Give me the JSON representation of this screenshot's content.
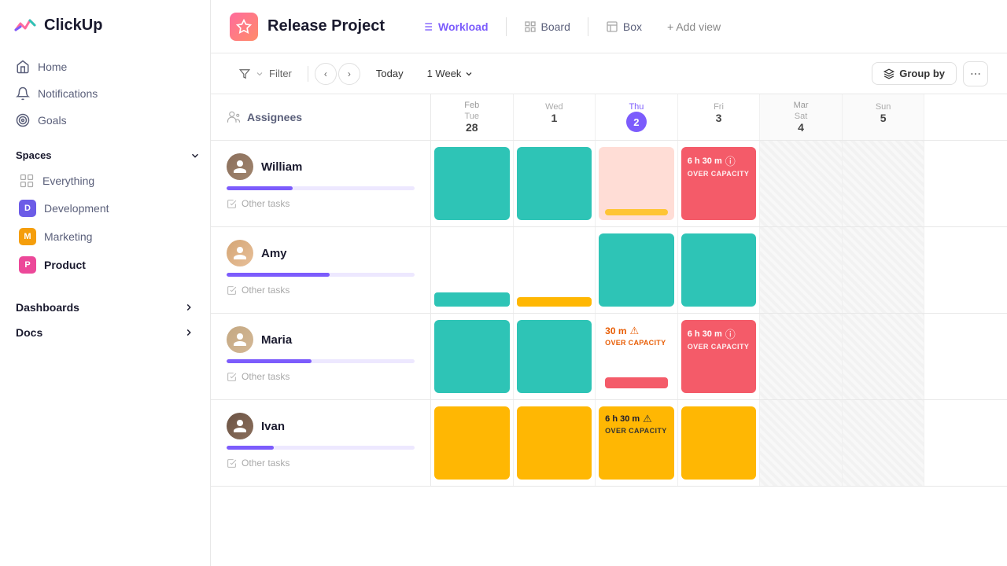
{
  "app": {
    "name": "ClickUp"
  },
  "sidebar": {
    "logo_text": "ClickUp",
    "nav_items": [
      {
        "id": "home",
        "label": "Home",
        "icon": "🏠"
      },
      {
        "id": "notifications",
        "label": "Notifications",
        "icon": "🔔"
      },
      {
        "id": "goals",
        "label": "Goals",
        "icon": "🎯"
      }
    ],
    "spaces_label": "Spaces",
    "space_items": [
      {
        "id": "everything",
        "label": "Everything",
        "icon": "grid",
        "color": null
      },
      {
        "id": "development",
        "label": "Development",
        "badge": "D",
        "color": "#6c5ce7"
      },
      {
        "id": "marketing",
        "label": "Marketing",
        "badge": "M",
        "color": "#f59e0b"
      },
      {
        "id": "product",
        "label": "Product",
        "badge": "P",
        "color": "#ec4899",
        "active": true
      }
    ],
    "dashboards_label": "Dashboards",
    "docs_label": "Docs"
  },
  "header": {
    "project_name": "Release Project",
    "tabs": [
      {
        "id": "workload",
        "label": "Workload",
        "active": true
      },
      {
        "id": "board",
        "label": "Board"
      },
      {
        "id": "box",
        "label": "Box"
      },
      {
        "id": "add",
        "label": "+ Add view"
      }
    ]
  },
  "toolbar": {
    "filter_label": "Filter",
    "today_label": "Today",
    "week_label": "1 Week",
    "group_by_label": "Group by"
  },
  "grid": {
    "assignees_label": "Assignees",
    "dates": [
      {
        "month": "Feb",
        "day_name": "Tue",
        "day_num": "28",
        "today": false,
        "weekend": false
      },
      {
        "month": "",
        "day_name": "Wed",
        "day_num": "1",
        "today": false,
        "weekend": false
      },
      {
        "month": "",
        "day_name": "Thu",
        "day_num": "2",
        "today": true,
        "weekend": false
      },
      {
        "month": "",
        "day_name": "Fri",
        "day_num": "3",
        "today": false,
        "weekend": false
      },
      {
        "month": "Mar",
        "day_name": "Sat",
        "day_num": "4",
        "today": false,
        "weekend": true
      },
      {
        "month": "",
        "day_name": "Sun",
        "day_num": "5",
        "today": false,
        "weekend": true
      }
    ],
    "assignees": [
      {
        "name": "William",
        "avatar_color": "#8b6f5c",
        "progress": 35,
        "other_tasks": "Other tasks",
        "cells": [
          {
            "type": "green",
            "spans": 1
          },
          {
            "type": "green",
            "spans": 1
          },
          {
            "type": "salmon-over",
            "spans": 1,
            "label": ""
          },
          {
            "type": "red-over",
            "spans": 1,
            "label": "6 h 30 m",
            "sublabel": "OVER CAPACITY"
          },
          {
            "type": "weekend"
          },
          {
            "type": "weekend"
          }
        ]
      },
      {
        "name": "Amy",
        "avatar_color": "#d4a574",
        "progress": 55,
        "other_tasks": "Other tasks",
        "cells": [
          {
            "type": "green-bottom",
            "spans": 1
          },
          {
            "type": "orange-bottom",
            "spans": 1
          },
          {
            "type": "green",
            "spans": 1
          },
          {
            "type": "green",
            "spans": 1
          },
          {
            "type": "weekend"
          },
          {
            "type": "weekend"
          }
        ]
      },
      {
        "name": "Maria",
        "avatar_color": "#c4a882",
        "progress": 45,
        "other_tasks": "Other tasks",
        "cells": [
          {
            "type": "green",
            "spans": 1
          },
          {
            "type": "green",
            "spans": 1
          },
          {
            "type": "orange-over",
            "spans": 1,
            "label": "30 m",
            "sublabel": "OVER CAPACITY"
          },
          {
            "type": "red-over",
            "spans": 1,
            "label": "6 h 30 m",
            "sublabel": "OVER CAPACITY"
          },
          {
            "type": "weekend"
          },
          {
            "type": "weekend"
          }
        ]
      },
      {
        "name": "Ivan",
        "avatar_color": "#6b5344",
        "progress": 25,
        "other_tasks": "Other tasks",
        "cells": [
          {
            "type": "orange",
            "spans": 1
          },
          {
            "type": "orange",
            "spans": 1
          },
          {
            "type": "orange-over",
            "spans": 1,
            "label": "6 h 30 m",
            "sublabel": "OVER CAPACITY"
          },
          {
            "type": "orange",
            "spans": 1
          },
          {
            "type": "weekend"
          },
          {
            "type": "weekend"
          }
        ]
      }
    ]
  }
}
